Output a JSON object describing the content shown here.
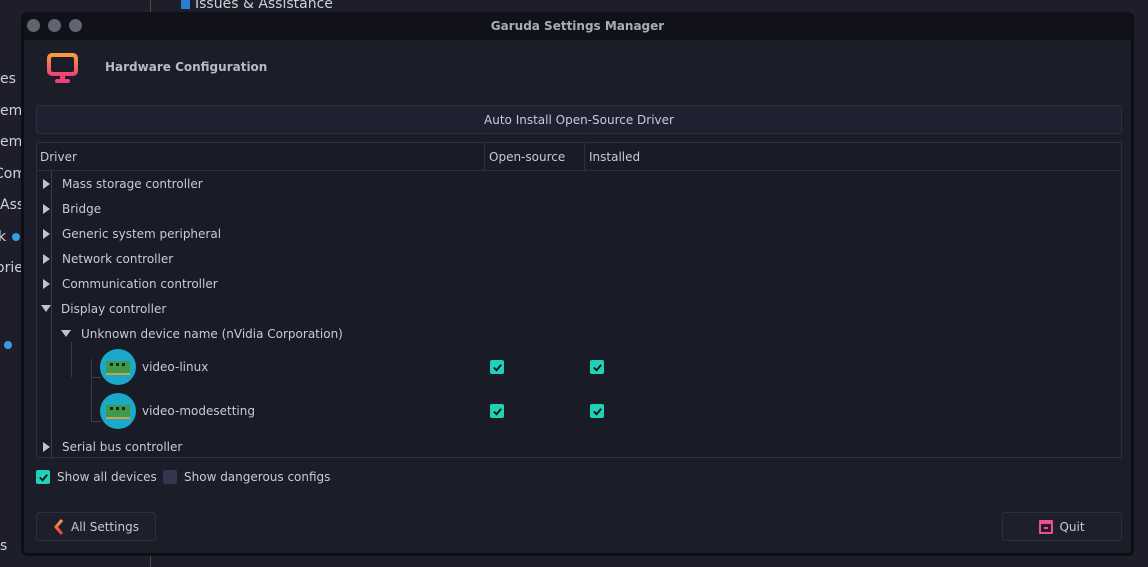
{
  "background": {
    "top_item": "Issues & Assistance",
    "left_fragments": [
      "es",
      "em",
      "em",
      "Com",
      "Ass",
      "k",
      "orie",
      "s"
    ]
  },
  "window": {
    "title": "Garuda Settings Manager",
    "header_title": "Hardware Configuration"
  },
  "auto_install_label": "Auto Install Open-Source Driver",
  "columns": [
    "Driver",
    "Open-source",
    "Installed"
  ],
  "tree": {
    "categories": [
      "Mass storage controller",
      "Bridge",
      "Generic system peripheral",
      "Network controller",
      "Communication controller",
      "Display controller",
      "Serial bus controller"
    ],
    "device": "Unknown device name (nVidia Corporation)",
    "drivers": [
      {
        "name": "video-linux",
        "open_source": true,
        "installed": true
      },
      {
        "name": "video-modesetting",
        "open_source": true,
        "installed": true
      }
    ]
  },
  "options": {
    "show_all_devices": {
      "label": "Show all devices",
      "checked": true
    },
    "show_dangerous": {
      "label": "Show dangerous configs",
      "checked": false
    }
  },
  "buttons": {
    "all_settings": "All Settings",
    "quit": "Quit"
  },
  "colors": {
    "accent": "#1fd1b9",
    "icon_gradient": [
      "#f7a23a",
      "#ef3f78"
    ]
  }
}
